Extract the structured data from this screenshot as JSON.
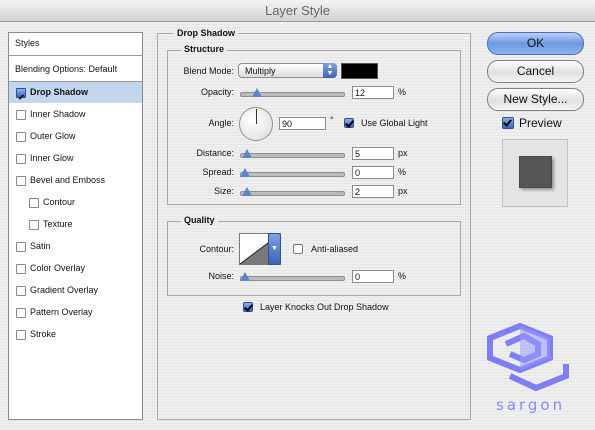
{
  "window": {
    "title": "Layer Style"
  },
  "styles_list": {
    "header": "Styles",
    "blending_options": "Blending Options: Default",
    "items": [
      {
        "label": "Drop Shadow",
        "checked": true,
        "selected": true,
        "indent": false
      },
      {
        "label": "Inner Shadow",
        "checked": false,
        "selected": false,
        "indent": false
      },
      {
        "label": "Outer Glow",
        "checked": false,
        "selected": false,
        "indent": false
      },
      {
        "label": "Inner Glow",
        "checked": false,
        "selected": false,
        "indent": false
      },
      {
        "label": "Bevel and Emboss",
        "checked": false,
        "selected": false,
        "indent": false
      },
      {
        "label": "Contour",
        "checked": false,
        "selected": false,
        "indent": true
      },
      {
        "label": "Texture",
        "checked": false,
        "selected": false,
        "indent": true
      },
      {
        "label": "Satin",
        "checked": false,
        "selected": false,
        "indent": false
      },
      {
        "label": "Color Overlay",
        "checked": false,
        "selected": false,
        "indent": false
      },
      {
        "label": "Gradient Overlay",
        "checked": false,
        "selected": false,
        "indent": false
      },
      {
        "label": "Pattern Overlay",
        "checked": false,
        "selected": false,
        "indent": false
      },
      {
        "label": "Stroke",
        "checked": false,
        "selected": false,
        "indent": false
      }
    ]
  },
  "drop_shadow": {
    "title": "Drop Shadow",
    "structure": {
      "title": "Structure",
      "blend_mode": {
        "label": "Blend Mode:",
        "value": "Multiply",
        "swatch_color": "#000000"
      },
      "opacity": {
        "label": "Opacity:",
        "value": "12",
        "unit": "%",
        "slider_level": 0.12
      },
      "angle": {
        "label": "Angle:",
        "value": "90",
        "unit": "°"
      },
      "use_global_light": {
        "label": "Use Global Light",
        "checked": true
      },
      "distance": {
        "label": "Distance:",
        "value": "5",
        "unit": "px",
        "slider_level": 0.02
      },
      "spread": {
        "label": "Spread:",
        "value": "0",
        "unit": "%",
        "slider_level": 0.0
      },
      "size": {
        "label": "Size:",
        "value": "2",
        "unit": "px",
        "slider_level": 0.02
      }
    },
    "quality": {
      "title": "Quality",
      "contour": {
        "label": "Contour:"
      },
      "anti_aliased": {
        "label": "Anti-aliased",
        "checked": false
      },
      "noise": {
        "label": "Noise:",
        "value": "0",
        "unit": "%",
        "slider_level": 0.0
      }
    },
    "layer_knocks_out": {
      "label": "Layer Knocks Out Drop Shadow",
      "checked": true
    }
  },
  "buttons": {
    "ok": "OK",
    "cancel": "Cancel",
    "new_style": "New Style...",
    "preview": {
      "label": "Preview",
      "checked": true
    }
  },
  "watermark": {
    "text": "sargon",
    "color": "#8888ff"
  }
}
